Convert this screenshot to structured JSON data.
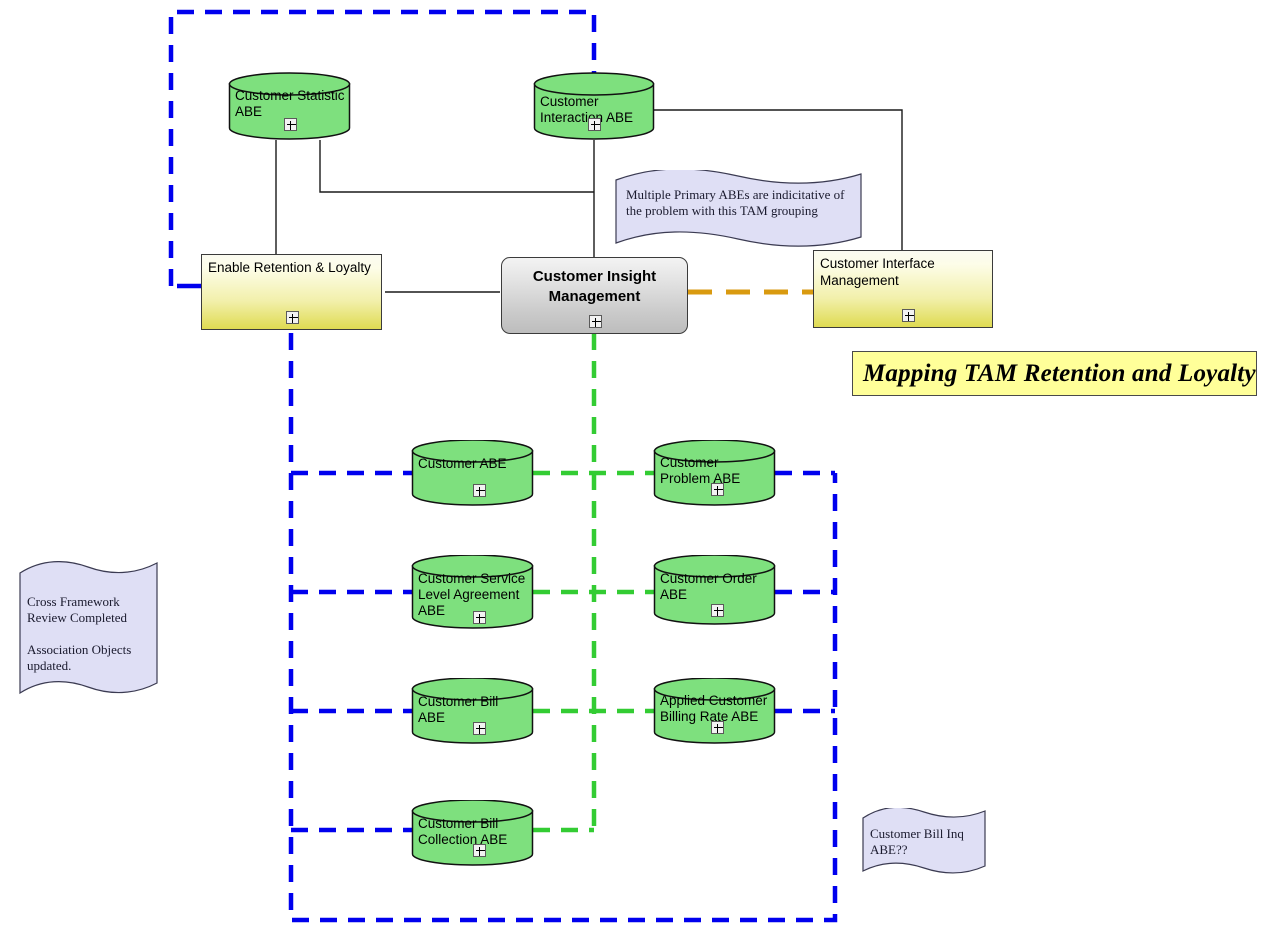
{
  "diagram": {
    "title": "Mapping TAM Retention and Loyalty",
    "colors": {
      "abe_fill": "#7ee07e",
      "process_yellow": "#e8e45a",
      "process_gray": "#cccccc",
      "note_fill": "#dfdff5",
      "blue_boundary": "#0000ee",
      "green_boundary": "#33cc33",
      "orange_link": "#d99a10",
      "banner_fill": "#ffff99"
    }
  },
  "abes": [
    {
      "id": "customer-statistic-abe",
      "label": "Customer Statistic\nABE"
    },
    {
      "id": "customer-interaction-abe",
      "label": "Customer\nInteraction ABE"
    },
    {
      "id": "customer-abe",
      "label": "Customer ABE"
    },
    {
      "id": "customer-problem-abe",
      "label": "Customer\nProblem ABE"
    },
    {
      "id": "customer-service-level-agreement-abe",
      "label": "Customer Service\nLevel Agreement\nABE"
    },
    {
      "id": "customer-order-abe",
      "label": "Customer Order\nABE"
    },
    {
      "id": "customer-bill-abe",
      "label": "Customer Bill ABE"
    },
    {
      "id": "applied-customer-billing-rate-abe",
      "label": "Applied Customer\nBilling Rate ABE"
    },
    {
      "id": "customer-bill-collection-abe",
      "label": "Customer Bill\nCollection ABE"
    }
  ],
  "processes": [
    {
      "id": "enable-retention-loyalty",
      "label": "Enable Retention & Loyalty"
    },
    {
      "id": "customer-insight-management",
      "label": "Customer Insight\nManagement"
    },
    {
      "id": "customer-interface-management",
      "label": "Customer Interface\nManagement"
    }
  ],
  "notes": [
    {
      "id": "note-multiple-primary-abes",
      "text": "Multiple Primary ABEs are indicitative of\nthe problem with this TAM grouping"
    },
    {
      "id": "note-cross-framework-review",
      "text": "Cross Framework\nReview Completed\n\nAssociation Objects\nupdated."
    },
    {
      "id": "note-customer-bill-inq",
      "text": "Customer Bill Inq\nABE??"
    }
  ]
}
